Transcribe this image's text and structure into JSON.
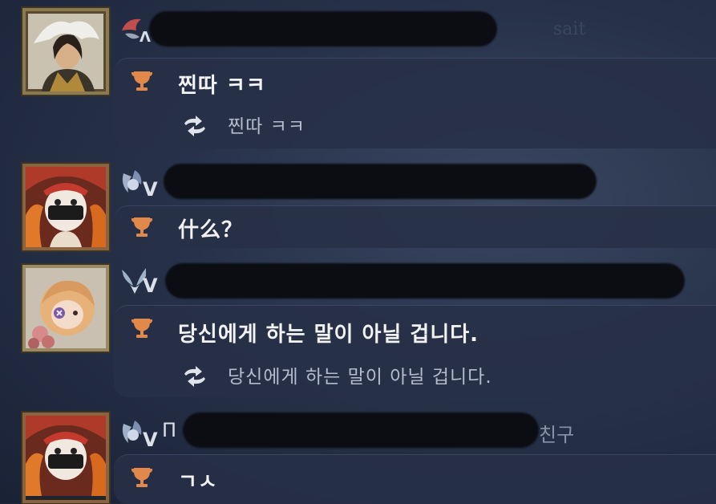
{
  "messages": [
    {
      "name_prefix": "",
      "text": "찐따 ㅋㅋ",
      "translation": "찐따 ㅋㅋ"
    },
    {
      "name_prefix": "V",
      "text": "什么？",
      "translation": ""
    },
    {
      "name_prefix": "V",
      "text": "당신에게 하는 말이 아닐 겁니다.",
      "translation": "당신에게 하는 말이 아닐 겁니다."
    },
    {
      "name_prefix": "V",
      "name_start": "Π",
      "name_suffix": "친구",
      "text": "ㄱㅅ",
      "translation": ""
    }
  ],
  "background": {
    "deco_text": "sait"
  },
  "colors": {
    "trophy": "#e0894a",
    "bubble": "#263046",
    "redaction": "#0b0d12",
    "frame": "#7a6a48"
  },
  "icons": {
    "trophy": "trophy-icon",
    "translate": "translate-arrows-icon",
    "badge": "rank-badge-icon"
  }
}
